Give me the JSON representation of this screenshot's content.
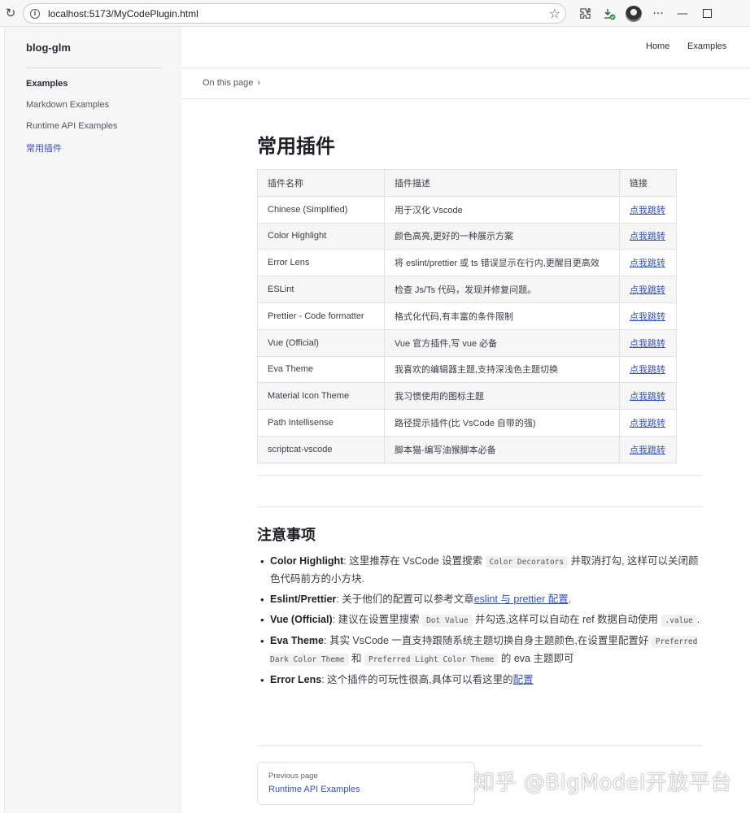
{
  "browser": {
    "url": "localhost:5173/MyCodePlugin.html"
  },
  "sidebar": {
    "site_title": "blog-glm",
    "group_title": "Examples",
    "items": [
      {
        "label": "Markdown Examples",
        "active": false
      },
      {
        "label": "Runtime API Examples",
        "active": false
      },
      {
        "label": "常用插件",
        "active": true
      }
    ]
  },
  "topnav": {
    "links": [
      "Home",
      "Examples"
    ]
  },
  "local_nav": {
    "label": "On this page"
  },
  "main": {
    "title": "常用插件",
    "table": {
      "headers": [
        "插件名称",
        "插件描述",
        "链接"
      ],
      "rows": [
        {
          "name": "Chinese (Simplified)",
          "desc": "用于汉化 Vscode",
          "link": "点我跳转"
        },
        {
          "name": "Color Highlight",
          "desc": "颜色高亮,更好的一种展示方案",
          "link": "点我跳转"
        },
        {
          "name": "Error Lens",
          "desc": "将 eslint/prettier 或 ts 错误显示在行内,更醒目更高效",
          "link": "点我跳转"
        },
        {
          "name": "ESLint",
          "desc": "检查 Js/Ts 代码，发现并修复问题。",
          "link": "点我跳转"
        },
        {
          "name": "Prettier - Code formatter",
          "desc": "格式化代码,有丰富的条件限制",
          "link": "点我跳转"
        },
        {
          "name": "Vue (Official)",
          "desc": "Vue 官方插件,写 vue 必备",
          "link": "点我跳转"
        },
        {
          "name": "Eva Theme",
          "desc": "我喜欢的编辑器主题,支持深浅色主题切换",
          "link": "点我跳转"
        },
        {
          "name": "Material Icon Theme",
          "desc": "我习惯使用的图标主题",
          "link": "点我跳转"
        },
        {
          "name": "Path Intellisense",
          "desc": "路径提示插件(比 VsCode 自带的强)",
          "link": "点我跳转"
        },
        {
          "name": "scriptcat-vscode",
          "desc": "脚本猫-编写油猴脚本必备",
          "link": "点我跳转"
        }
      ]
    },
    "notes_title": "注意事项",
    "notes": {
      "color_highlight": {
        "term": "Color Highlight",
        "text1": ": 这里推荐在 VsCode 设置搜索 ",
        "code": "Color Decorators",
        "text2": " 并取消打勾, 这样可以关闭颜色代码前方的小方块."
      },
      "eslint": {
        "term": "Eslint/Prettier",
        "text1": ": 关于他们的配置可以参考文章",
        "link": "eslint 与 prettier 配置",
        "text2": "."
      },
      "vue": {
        "term": "Vue (Official)",
        "text1": ": 建议在设置里搜索 ",
        "code": "Dot Value",
        "text2": " 并勾选,这样可以自动在 ref 数据自动使用 ",
        "code2": ".value",
        "text3": "."
      },
      "eva": {
        "term": "Eva Theme",
        "text1": ": 其实 VsCode 一直支持跟随系统主题切换自身主题颜色,在设置里配置好 ",
        "code": "Preferred Dark Color Theme",
        "text2": " 和 ",
        "code2": "Preferred Light Color Theme",
        "text3": " 的 eva 主题即可"
      },
      "error_lens": {
        "term": "Error Lens",
        "text1": ": 这个插件的可玩性很高,具体可以看这里的",
        "link": "配置"
      }
    },
    "prev_page": {
      "label": "Previous page",
      "title": "Runtime API Examples"
    }
  },
  "watermark": "知乎 @BigModel开放平台",
  "colors": {
    "accent": "#3451b2",
    "sidebar_bg": "#f6f6f7"
  }
}
